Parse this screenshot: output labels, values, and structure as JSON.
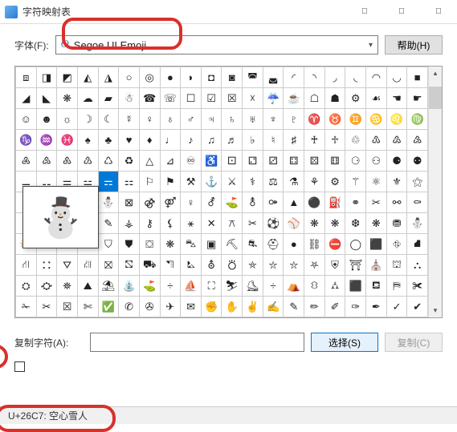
{
  "window": {
    "title": "字符映射表"
  },
  "fontRow": {
    "label": "字体(F):",
    "selectedFont": "Segoe UI Emoji",
    "helpLabel": "帮助(H)"
  },
  "grid": {
    "rows": [
      [
        "⧈",
        "◨",
        "◩",
        "◭",
        "◮",
        "○",
        "◎",
        "●",
        "◗",
        "◘",
        "◙",
        "◚",
        "◛",
        "◜",
        "◝",
        "◞",
        "◟",
        "◠",
        "◡",
        "■"
      ],
      [
        "◢",
        "◣",
        "❋",
        "☁",
        "▰",
        "☃",
        "☎",
        "☏",
        "☐",
        "☑",
        "☒",
        "☓",
        "☔",
        "☕",
        "☖",
        "☗",
        "⚙",
        "☙",
        "☚",
        "☛"
      ],
      [
        "☺",
        "☻",
        "☼",
        "☽",
        "☾",
        "☿",
        "♀",
        "♁",
        "♂",
        "♃",
        "♄",
        "♅",
        "♆",
        "♇",
        "♈",
        "♉",
        "♊",
        "♋",
        "♌",
        "♍"
      ],
      [
        "♑",
        "♒",
        "♓",
        "♠",
        "♣",
        "♥",
        "♦",
        "♩",
        "♪",
        "♫",
        "♬",
        "♭",
        "♮",
        "♯",
        "♰",
        "♱",
        "♲",
        "♳",
        "♴",
        "♵"
      ],
      [
        "♶",
        "♷",
        "♸",
        "♹",
        "♺",
        "♻",
        "△",
        "⊿",
        "♾",
        "♿",
        "⚀",
        "⚁",
        "⚂",
        "⚃",
        "⚄",
        "⚅",
        "⚆",
        "⚇",
        "⚈",
        "⚉"
      ],
      [
        "⚊",
        "⚋",
        "⚌",
        "⚍",
        "⚎",
        "⚏",
        "⚐",
        "⚑",
        "⚒",
        "⚓",
        "⚔",
        "⚕",
        "⚖",
        "⚗",
        "⚘",
        "⚙",
        "⚚",
        "⚛",
        "⚜",
        "⚝"
      ],
      [
        "⚞",
        "⚟",
        "▣",
        "⚠",
        "⛄",
        "⊠",
        "⚣",
        "⚤",
        "♀",
        "⚦",
        "⛳",
        "⚨",
        "⚩",
        "▲",
        "⚫",
        "⛽",
        "⚭",
        "✂",
        "⚯",
        "⚰"
      ],
      [
        "⚱",
        "⚲",
        "⚳",
        "⚴",
        "✎",
        "⚶",
        "⚷",
        "⚸",
        "⚹",
        "✕",
        "⚻",
        "✂",
        "⚽",
        "⚾",
        "❋",
        "❋",
        "❆",
        "❋",
        "⛃",
        "⛄"
      ],
      [
        "⛅",
        "⛆",
        "⛇",
        "⛈",
        "⛉",
        "⛊",
        "⛋",
        "❋",
        "⛍",
        "▣",
        "⛏",
        "⛐",
        "⛑",
        "●",
        "⛓",
        "⛔",
        "◯",
        "⬛",
        "⛗",
        "⛘"
      ],
      [
        "⛙",
        "⛚",
        "⛛",
        "⛜",
        "⛝",
        "⛞",
        "⛟",
        "⛠",
        "⛡",
        "⛢",
        "⛣",
        "⛤",
        "⛥",
        "⛦",
        "⛧",
        "⛨",
        "⛩",
        "⛪",
        "⛫",
        "⛬"
      ],
      [
        "⛭",
        "⛮",
        "⛯",
        "⛰",
        "⛱",
        "⛲",
        "⛳",
        "÷",
        "⛵",
        "⛶",
        "⛷",
        "⛸",
        "÷",
        "⛺",
        "⛻",
        "⛼",
        "⬛",
        "⛾",
        "⛿",
        "✀"
      ],
      [
        "✁",
        "✂",
        "☒",
        "✄",
        "✅",
        "✆",
        "✇",
        "✈",
        "✉",
        "✊",
        "✋",
        "✌",
        "✍",
        "✎",
        "✏",
        "✐",
        "✑",
        "✒",
        "✓",
        "✔"
      ]
    ],
    "selected": {
      "row": 5,
      "col": 4
    },
    "previewGlyph": "⛄"
  },
  "copyRow": {
    "label": "复制字符(A):",
    "value": "",
    "selectLabel": "选择(S)",
    "copyLabel": "复制(C)"
  },
  "status": {
    "text": "U+26C7: 空心雪人"
  }
}
